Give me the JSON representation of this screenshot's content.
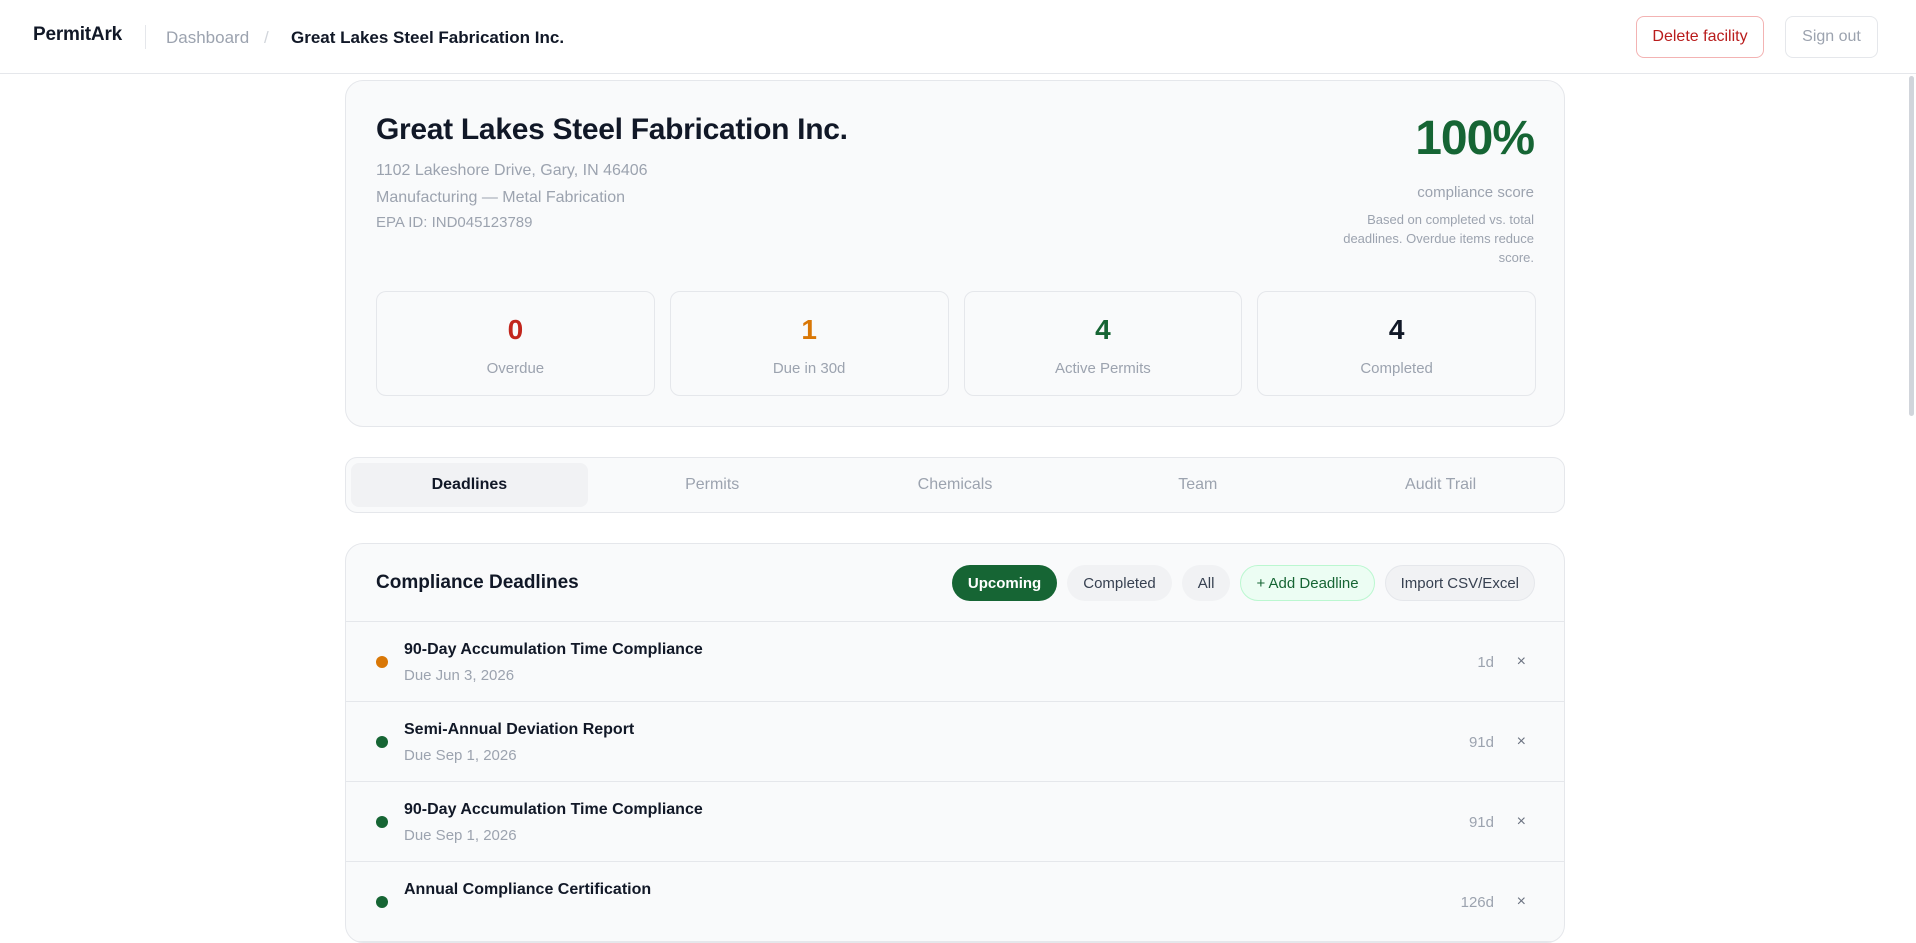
{
  "header": {
    "brand": "PermitArk",
    "breadcrumb_dashboard": "Dashboard",
    "breadcrumb_sep": "/",
    "breadcrumb_current": "Great Lakes Steel Fabrication Inc.",
    "delete_label": "Delete facility",
    "signout_label": "Sign out"
  },
  "facility": {
    "name": "Great Lakes Steel Fabrication Inc.",
    "address": "1102 Lakeshore Drive, Gary, IN 46406",
    "industry": "Manufacturing — Metal Fabrication",
    "epa_id": "EPA ID: IND045123789",
    "score": "100%",
    "score_label": "compliance score",
    "score_note": "Based on completed vs. total deadlines. Overdue items reduce score."
  },
  "stats": [
    {
      "value": "0",
      "label": "Overdue",
      "color": "#c2261d"
    },
    {
      "value": "1",
      "label": "Due in 30d",
      "color": "#d97706"
    },
    {
      "value": "4",
      "label": "Active Permits",
      "color": "#166534"
    },
    {
      "value": "4",
      "label": "Completed",
      "color": "#111827"
    }
  ],
  "tabs": [
    {
      "label": "Deadlines",
      "active": true
    },
    {
      "label": "Permits",
      "active": false
    },
    {
      "label": "Chemicals",
      "active": false
    },
    {
      "label": "Team",
      "active": false
    },
    {
      "label": "Audit Trail",
      "active": false
    }
  ],
  "deadlines": {
    "title": "Compliance Deadlines",
    "filters": {
      "upcoming": "Upcoming",
      "completed": "Completed",
      "all": "All"
    },
    "add_label": "+ Add Deadline",
    "import_label": "Import CSV/Excel",
    "items": [
      {
        "title": "90-Day Accumulation Time Compliance",
        "due": "Due Jun 3, 2026",
        "days": "1d",
        "status_color": "#d97706"
      },
      {
        "title": "Semi-Annual Deviation Report",
        "due": "Due Sep 1, 2026",
        "days": "91d",
        "status_color": "#166534"
      },
      {
        "title": "90-Day Accumulation Time Compliance",
        "due": "Due Sep 1, 2026",
        "days": "91d",
        "status_color": "#166534"
      },
      {
        "title": "Annual Compliance Certification",
        "due": "",
        "days": "126d",
        "status_color": "#166534"
      }
    ],
    "remove_glyph": "×"
  }
}
